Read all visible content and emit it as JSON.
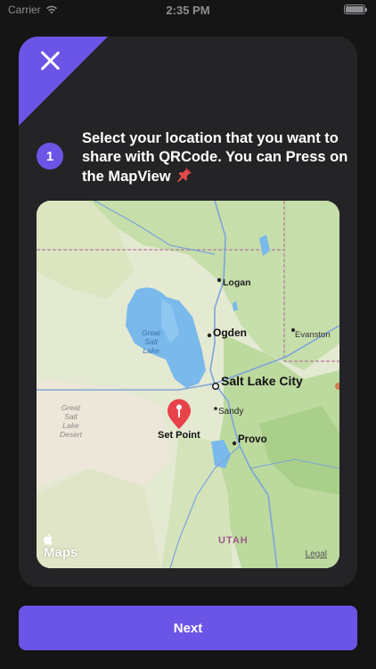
{
  "status_bar": {
    "carrier": "Carrier",
    "time": "2:35 PM"
  },
  "step": {
    "number": "1",
    "instruction": "Select your location that you want to share with QRCode. You can Press on the MapView"
  },
  "map": {
    "cities": {
      "logan": "Logan",
      "ogden": "Ogden",
      "evanston": "Evanston",
      "salt_lake_city": "Salt Lake City",
      "sandy": "Sandy",
      "provo": "Provo"
    },
    "lake_label_1": "Great",
    "lake_label_2": "Salt",
    "lake_label_3": "Lake",
    "desert_label_1": "Great",
    "desert_label_2": "Salt",
    "desert_label_3": "Lake",
    "desert_label_4": "Desert",
    "state_label": "UTAH",
    "pin_label": "Set Point",
    "brand": "Maps",
    "legal": "Legal"
  },
  "next_button": {
    "label": "Next"
  },
  "colors": {
    "accent": "#6b55e6",
    "background": "#151515",
    "card": "#242427",
    "pin": "#e8424a"
  }
}
